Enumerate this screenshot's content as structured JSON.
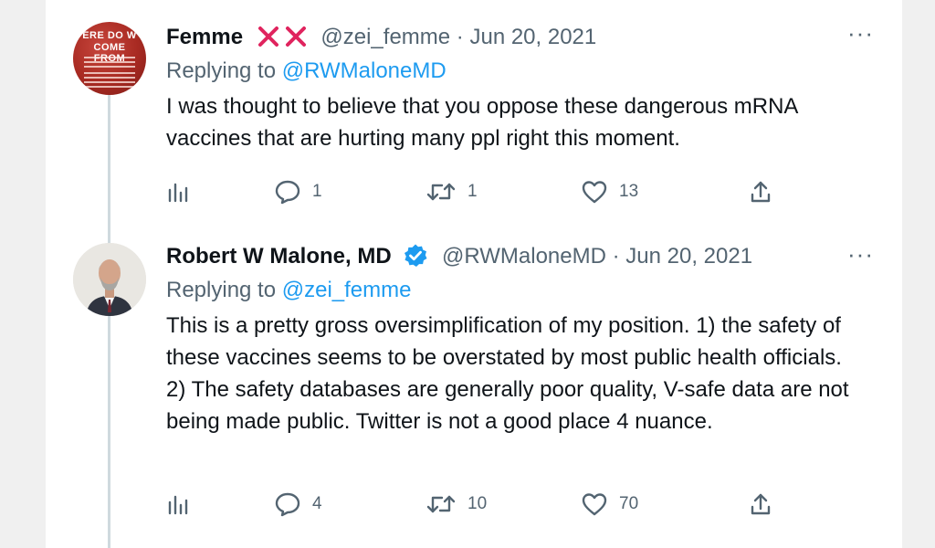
{
  "tweets": [
    {
      "name": "Femme",
      "handle": "@zei_femme",
      "date": "Jun 20, 2021",
      "replying_label": "Replying to",
      "replying_to": "@RWMaloneMD",
      "text": "I was thought to believe that you oppose these dangerous mRNA vaccines that are hurting many ppl right this moment.",
      "avatar_text": [
        "ERE DO W",
        "COME FROM"
      ],
      "stats": {
        "replies": "1",
        "retweets": "1",
        "likes": "13"
      }
    },
    {
      "name": "Robert W Malone, MD",
      "handle": "@RWMaloneMD",
      "date": "Jun 20, 2021",
      "replying_label": "Replying to",
      "replying_to": "@zei_femme",
      "text": "This is a pretty gross oversimplification of my position.  1) the safety of these vaccines seems to be overstated by most public health officials. 2) The safety databases are generally poor quality, V-safe data are not being made public.  Twitter is not a good place 4 nuance.",
      "stats": {
        "replies": "4",
        "retweets": "10",
        "likes": "70"
      }
    }
  ],
  "separator": " · ",
  "more_label": "···",
  "colors": {
    "text": "#0f1419",
    "muted": "#536471",
    "link": "#1d9bf0",
    "x_mark": "#e0245e",
    "verified": "#1d9bf0"
  }
}
